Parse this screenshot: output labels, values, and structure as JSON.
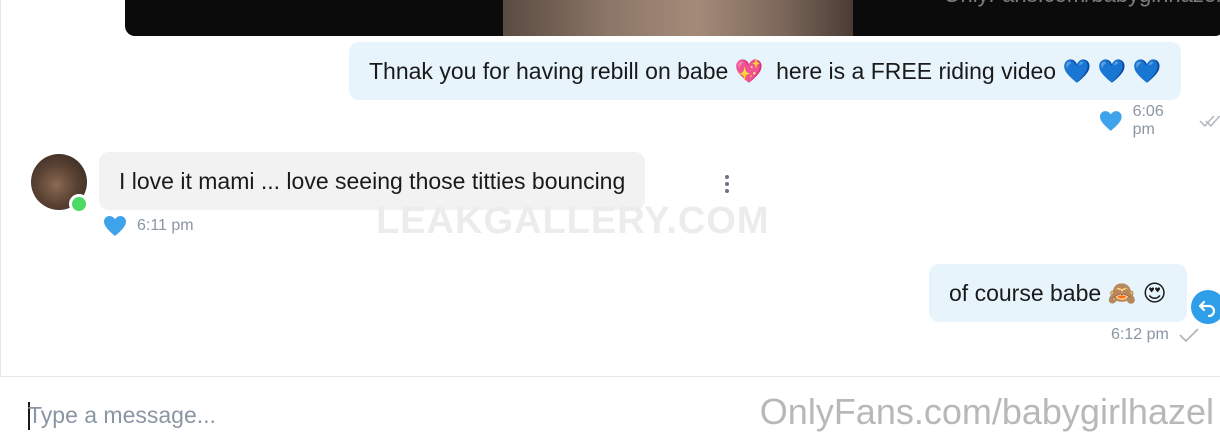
{
  "chat": {
    "video_preview": {
      "watermark": "OnlyFans.com/babygirlhazel"
    },
    "messages": [
      {
        "direction": "outgoing",
        "text_before": "Thnak you for having rebill on babe ",
        "emoji_heart_sparkle": "💖",
        "text_middle": "  here is a FREE riding video ",
        "emoji_blue_hearts": "💙 💙 💙",
        "time": "6:06 pm",
        "liked": true,
        "status": "read"
      },
      {
        "direction": "incoming",
        "text": "I love it mami ... love seeing those titties bouncing",
        "time": "6:11 pm",
        "liked": true
      },
      {
        "direction": "outgoing",
        "text": "of course babe ",
        "emojis": "🙈 😍",
        "time": "6:12 pm",
        "status": "sent"
      }
    ],
    "watermark_center": "LEAKGALLERY.COM"
  },
  "composer": {
    "placeholder": "Type a message...",
    "watermark": "OnlyFans.com/babygirlhazel"
  },
  "colors": {
    "outgoing_bubble": "#e7f4fc",
    "incoming_bubble": "#f2f2f2",
    "heart": "#2f9ee8",
    "online": "#4cd964",
    "meta_text": "#8a96a3"
  },
  "icons": [
    "heart-icon",
    "double-check-icon",
    "check-icon",
    "more-vertical-icon",
    "undo-icon",
    "online-status-icon"
  ]
}
